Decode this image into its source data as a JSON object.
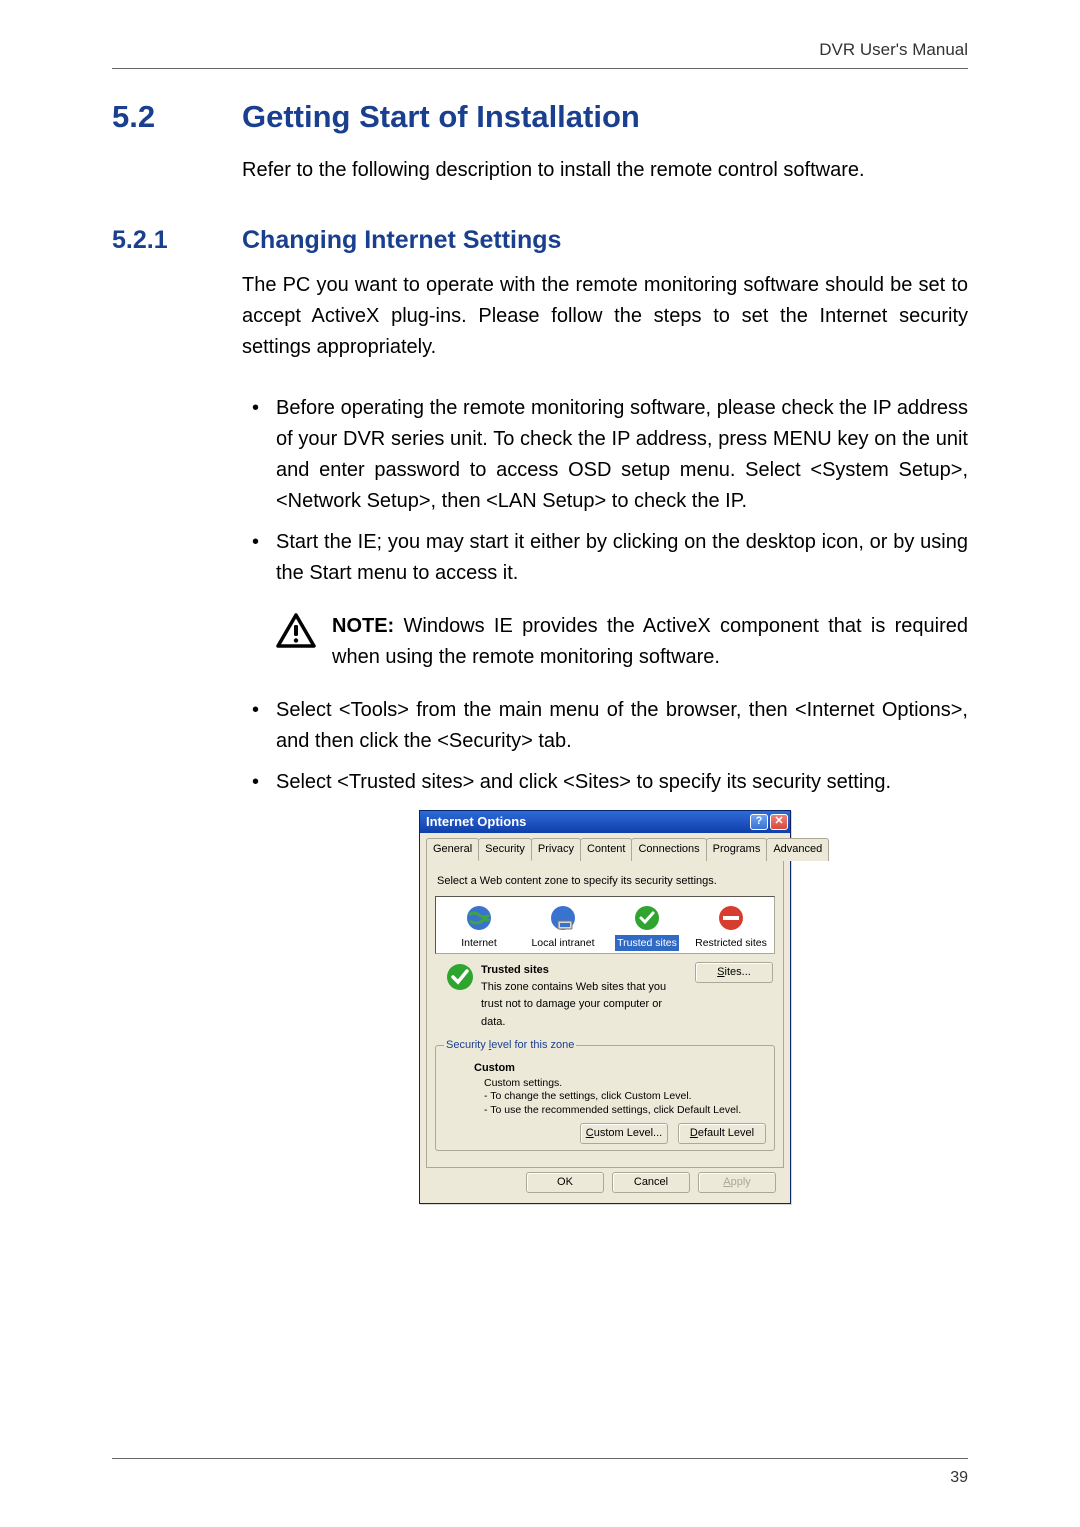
{
  "header": {
    "doc_title": "DVR User's Manual"
  },
  "section": {
    "num": "5.2",
    "title": "Getting Start of Installation",
    "intro": "Refer to the following description to install the remote control software."
  },
  "subsection": {
    "num": "5.2.1",
    "title": "Changing Internet Settings",
    "intro": "The PC you want to operate with the remote monitoring software should be set to accept ActiveX plug-ins. Please follow the steps to set the Internet security settings appropriately."
  },
  "bullets_a": [
    "Before operating the remote monitoring software, please check the IP address of your DVR series unit. To check the IP address, press MENU key on the unit and enter password to access OSD setup menu. Select <System Setup>, <Network Setup>, then <LAN Setup> to check the IP.",
    "Start the IE; you may start it either by clicking on the desktop icon, or by using the Start menu to access it."
  ],
  "note": {
    "label": "NOTE:",
    "text": " Windows IE provides the ActiveX component that is required when using the remote monitoring software."
  },
  "bullets_b": [
    "Select <Tools> from the main menu of the browser, then <Internet Options>, and then click the <Security> tab.",
    "Select <Trusted sites> and click <Sites> to specify its security setting."
  ],
  "dialog": {
    "title": "Internet Options",
    "tabs": [
      "General",
      "Security",
      "Privacy",
      "Content",
      "Connections",
      "Programs",
      "Advanced"
    ],
    "active_tab": "Security",
    "zone_instruction": "Select a Web content zone to specify its security settings.",
    "zones": [
      {
        "name": "Internet"
      },
      {
        "name": "Local intranet"
      },
      {
        "name": "Trusted sites"
      },
      {
        "name": "Restricted sites"
      }
    ],
    "selected_zone": "Trusted sites",
    "trusted_title": "Trusted sites",
    "trusted_desc": "This zone contains Web sites that you trust not to damage your computer or data.",
    "sites_button": "Sites...",
    "security_level_legend": "Security level for this zone",
    "level_name": "Custom",
    "level_desc_1": "Custom settings.",
    "level_desc_2": "- To change the settings, click Custom Level.",
    "level_desc_3": "- To use the recommended settings, click Default Level.",
    "custom_level_btn": "Custom Level...",
    "default_level_btn": "Default Level",
    "ok_btn": "OK",
    "cancel_btn": "Cancel",
    "apply_btn": "Apply"
  },
  "footer": {
    "page_number": "39"
  }
}
